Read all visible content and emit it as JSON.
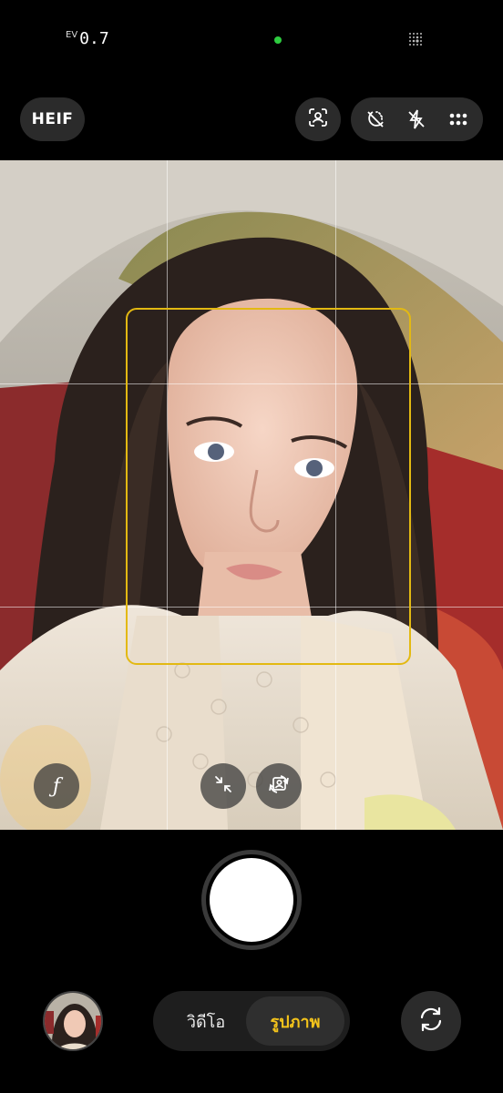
{
  "status": {
    "ev_label": "EV",
    "ev_value": "0.7",
    "indicator_color": "#2ecc40"
  },
  "toolbar": {
    "format_label": "HEIF",
    "icons": [
      "portrait-focus-icon",
      "filter-off-icon",
      "flash-off-icon",
      "more-options-icon"
    ]
  },
  "viewfinder": {
    "aperture_label": "ƒ",
    "face_box_color": "#e3b912"
  },
  "modes": {
    "video_label": "วิดีโอ",
    "photo_label": "รูปภาพ",
    "active_color": "#f3c31b"
  }
}
